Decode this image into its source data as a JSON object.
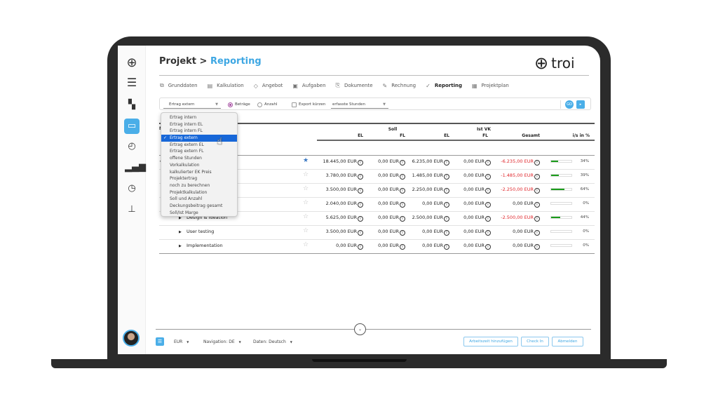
{
  "header": {
    "section": "Projekt",
    "separator": ">",
    "current": "Reporting",
    "logo_text": "troi"
  },
  "sidebar": {
    "items": [
      {
        "icon": "troi-logo-icon"
      },
      {
        "icon": "menu-icon"
      },
      {
        "icon": "dashboard-icon"
      },
      {
        "icon": "folder-icon",
        "active": true
      },
      {
        "icon": "stopwatch-icon"
      },
      {
        "icon": "bar-chart-icon"
      },
      {
        "icon": "clock-user-icon"
      },
      {
        "icon": "stamp-icon"
      }
    ]
  },
  "tabs": [
    {
      "label": "Grunddaten",
      "icon": "folder-icon"
    },
    {
      "label": "Kalkulation",
      "icon": "calculator-icon"
    },
    {
      "label": "Angebot",
      "icon": "tag-icon"
    },
    {
      "label": "Aufgaben",
      "icon": "task-icon"
    },
    {
      "label": "Dokumente",
      "icon": "document-icon"
    },
    {
      "label": "Rechnung",
      "icon": "invoice-icon"
    },
    {
      "label": "Reporting",
      "icon": "check-chart-icon",
      "active": true
    },
    {
      "label": "Projektplan",
      "icon": "calendar-icon"
    }
  ],
  "filter": {
    "report_type": "Ertrag extern",
    "radio_amounts": "Beträge",
    "radio_count": "Anzahl",
    "radio_selected": "Beträge",
    "export_short": "Export kürzen",
    "hours_select": "erfasste Stunden",
    "btn1": "GO",
    "btn2": "▸"
  },
  "dropdown": {
    "selected": "Ertrag extern",
    "options": [
      "Ertrag intern",
      "Ertrag intern EL",
      "Ertrag intern FL",
      "Ertrag extern",
      "Ertrag extern EL",
      "Ertrag extern FL",
      "offene Stunden",
      "Vorkalkulation",
      "kalkulierter EK Preis",
      "Projektertrag",
      "noch zu berechnen",
      "Projektkalkulation",
      "Soll und Anzahl",
      "Deckungsbeitrag gesamt",
      "Soll/Ist Marge"
    ]
  },
  "table": {
    "name_header": "N",
    "group_soll": "Soll",
    "group_ist": "Ist VK",
    "columns": [
      "EL",
      "FL",
      "EL",
      "FL",
      "Gesamt",
      "i/s in %"
    ],
    "rows": [
      {
        "name": "",
        "fav": true,
        "values": [
          "18.445,00 EUR",
          "0,00 EUR",
          "6.235,00 EUR",
          "0,00 EUR",
          "-6.235,00 EUR"
        ],
        "negative": true,
        "pct": 34
      },
      {
        "name": "",
        "fav": false,
        "values": [
          "3.780,00 EUR",
          "0,00 EUR",
          "1.485,00 EUR",
          "0,00 EUR",
          "-1.485,00 EUR"
        ],
        "negative": true,
        "pct": 39
      },
      {
        "name": "",
        "fav": false,
        "values": [
          "3.500,00 EUR",
          "0,00 EUR",
          "2.250,00 EUR",
          "0,00 EUR",
          "-2.250,00 EUR"
        ],
        "negative": true,
        "pct": 64
      },
      {
        "name": "",
        "fav": false,
        "values": [
          "2.040,00 EUR",
          "0,00 EUR",
          "0,00 EUR",
          "0,00 EUR",
          "0,00 EUR"
        ],
        "negative": false,
        "pct": 0
      },
      {
        "name": "Design & Ideation",
        "fav": false,
        "values": [
          "5.625,00 EUR",
          "0,00 EUR",
          "2.500,00 EUR",
          "0,00 EUR",
          "-2.500,00 EUR"
        ],
        "negative": true,
        "pct": 44
      },
      {
        "name": "User testing",
        "fav": false,
        "values": [
          "3.500,00 EUR",
          "0,00 EUR",
          "0,00 EUR",
          "0,00 EUR",
          "0,00 EUR"
        ],
        "negative": false,
        "pct": 0
      },
      {
        "name": "Implementation",
        "fav": false,
        "values": [
          "0,00 EUR",
          "0,00 EUR",
          "0,00 EUR",
          "0,00 EUR",
          "0,00 EUR"
        ],
        "negative": false,
        "pct": 0
      }
    ]
  },
  "footer": {
    "currency": "EUR",
    "navigation": "Navigation: DE",
    "data_lang": "Daten: Deutsch",
    "add_worktime": "Arbeitszeit hinzufügen",
    "check_in": "Check In",
    "logout": "Abmelden"
  },
  "colors": {
    "accent": "#3ea7e3",
    "negative": "#e0262b",
    "progress": "#1b9c1b",
    "selected": "#1767d8"
  }
}
